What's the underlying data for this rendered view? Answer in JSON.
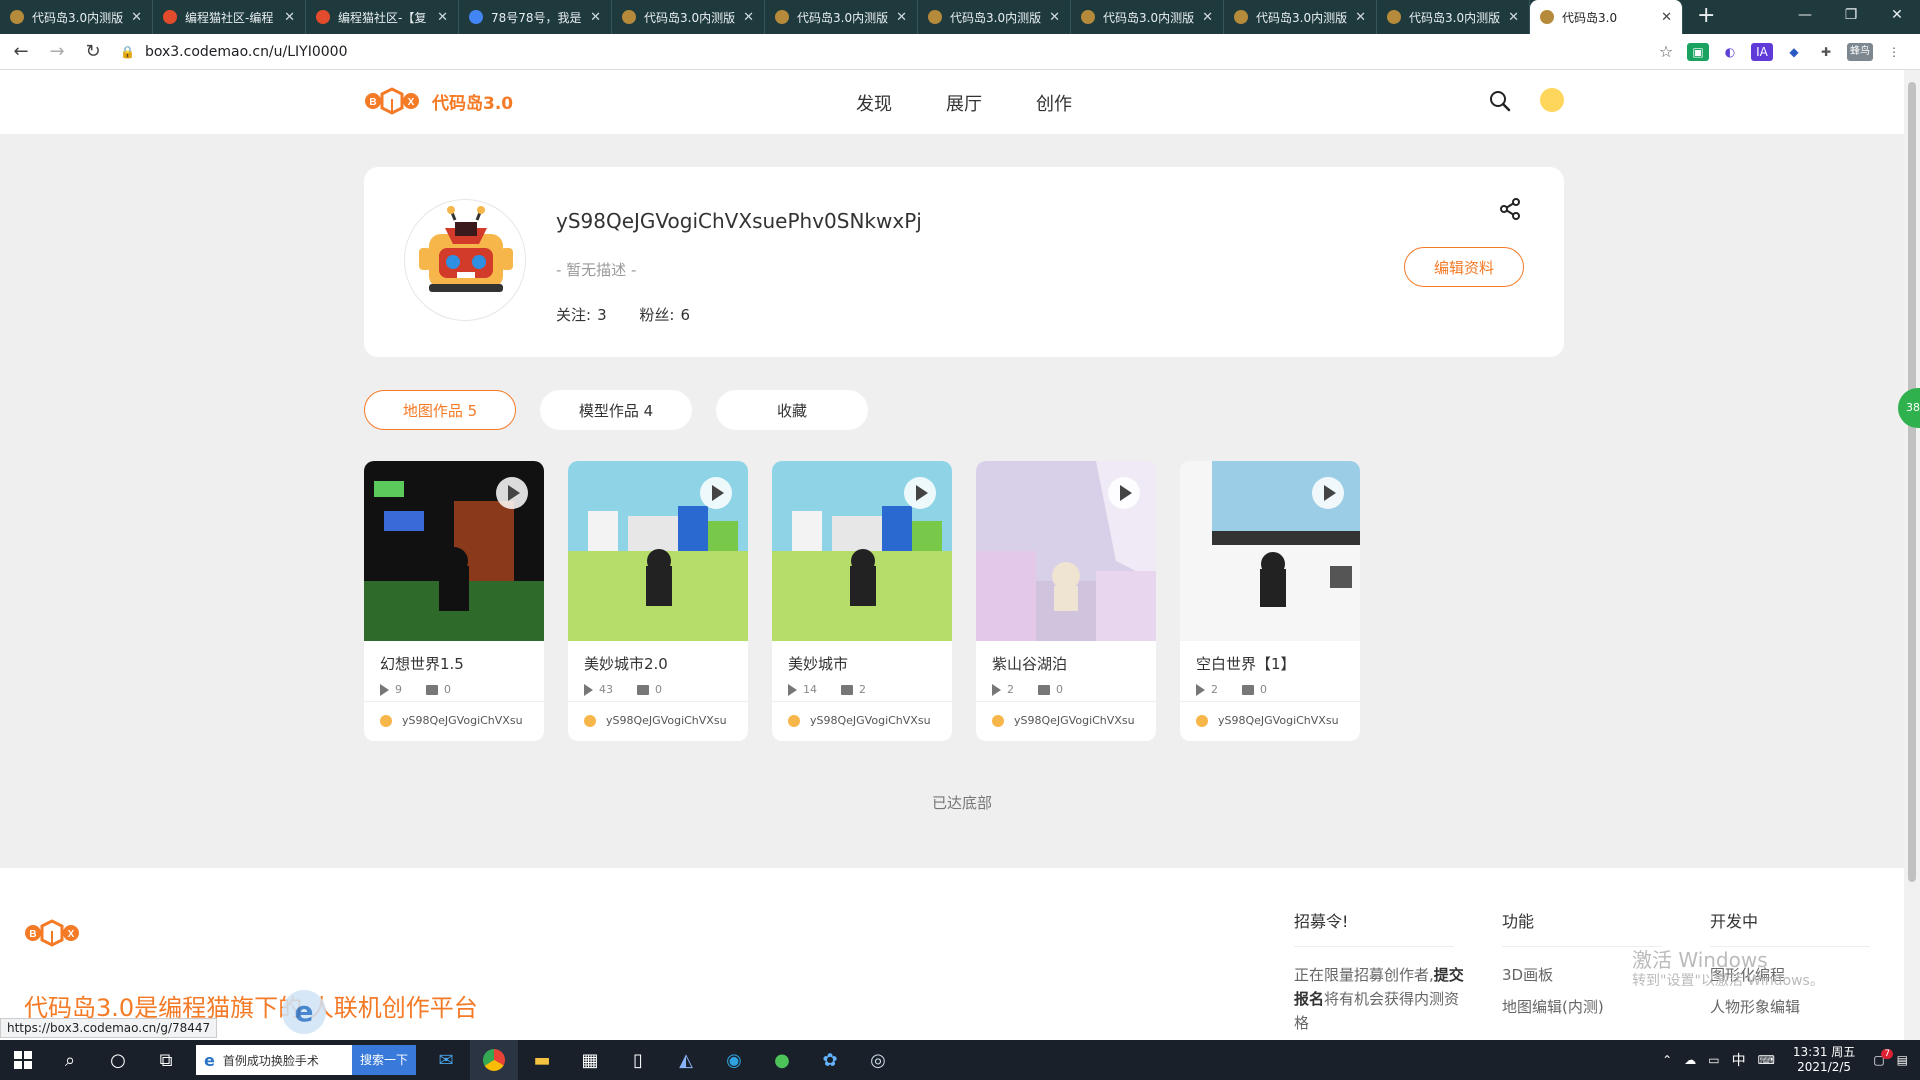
{
  "browser": {
    "tabs": [
      {
        "title": "代码岛3.0内测版",
        "fav": "#b58a3a"
      },
      {
        "title": "编程猫社区-编程",
        "fav": "#e24b2b"
      },
      {
        "title": "编程猫社区-【复",
        "fav": "#e24b2b"
      },
      {
        "title": "78号78号，我是",
        "fav": "#4285f4"
      },
      {
        "title": "代码岛3.0内测版",
        "fav": "#b58a3a"
      },
      {
        "title": "代码岛3.0内测版",
        "fav": "#b58a3a"
      },
      {
        "title": "代码岛3.0内测版",
        "fav": "#b58a3a"
      },
      {
        "title": "代码岛3.0内测版",
        "fav": "#b58a3a"
      },
      {
        "title": "代码岛3.0内测版",
        "fav": "#b58a3a"
      },
      {
        "title": "代码岛3.0内测版",
        "fav": "#b58a3a"
      },
      {
        "title": "代码岛3.0",
        "fav": "#b58a3a"
      }
    ],
    "url": "box3.codemao.cn/u/LIYI0000",
    "profile_ext": "蜂鸟"
  },
  "site": {
    "logo_text": "代码岛3.0",
    "nav": [
      "发现",
      "展厅",
      "创作"
    ],
    "accent": "#f47a26"
  },
  "profile": {
    "username": "yS98QeJGVogiChVXsuePhv0SNkwxPj",
    "description": "- 暂无描述 -",
    "following_label": "关注:",
    "following": "3",
    "followers_label": "粉丝:",
    "followers": "6",
    "edit_button": "编辑资料"
  },
  "tabs": [
    {
      "label": "地图作品 5"
    },
    {
      "label": "模型作品 4"
    },
    {
      "label": "收藏"
    }
  ],
  "works": [
    {
      "title": "幻想世界1.5",
      "plays": "9",
      "comments": "0",
      "author": "yS98QeJGVogiChVXsu"
    },
    {
      "title": "美妙城市2.0",
      "plays": "43",
      "comments": "0",
      "author": "yS98QeJGVogiChVXsu"
    },
    {
      "title": "美妙城市",
      "plays": "14",
      "comments": "2",
      "author": "yS98QeJGVogiChVXsu"
    },
    {
      "title": "紫山谷湖泊",
      "plays": "2",
      "comments": "0",
      "author": "yS98QeJGVogiChVXsu"
    },
    {
      "title": "空白世界【1】",
      "plays": "2",
      "comments": "0",
      "author": "yS98QeJGVogiChVXsu"
    }
  ],
  "bottom_text": "已达底部",
  "footer": {
    "slogan": "代码岛3.0是编程猫旗下的 人联机创作平台",
    "col1": {
      "title": "招募令!",
      "text_pre": "正在限量招募创作者,",
      "text_bold": "提交报名",
      "text_post": "将有机会获得内测资格"
    },
    "col2": {
      "title": "功能",
      "items": [
        "3D画板",
        "地图编辑(内测)"
      ]
    },
    "col3": {
      "title": "开发中",
      "items": [
        "图形化编程",
        "人物形象编辑"
      ]
    }
  },
  "watermark": {
    "line1": "激活 Windows",
    "line2": "转到\"设置\"以激活 Windows。"
  },
  "status_url": "https://box3.codemao.cn/g/78447",
  "side_badge": "38",
  "taskbar": {
    "search_text": "首例成功换脸手术",
    "search_btn": "搜索一下",
    "ime": "中",
    "time": "13:31 周五",
    "date": "2021/2/5",
    "notif_count": "7"
  }
}
